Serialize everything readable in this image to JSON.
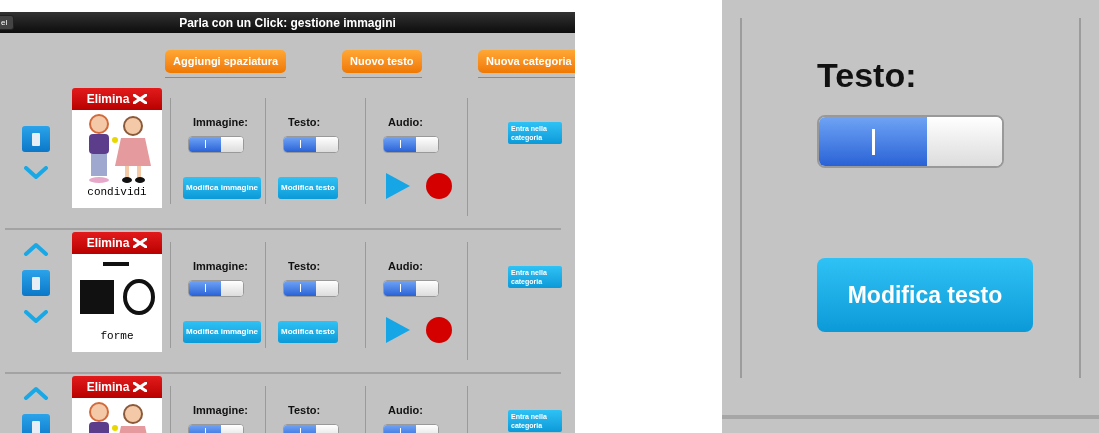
{
  "app": {
    "back_button": "el",
    "title": "Parla con un Click: gestione immagini",
    "toolbar": [
      "Aggiungi spaziatura",
      "Nuovo testo",
      "Nuova categoria"
    ],
    "rows": [
      {
        "has_up": false,
        "has_down": true,
        "delete": "Elimina",
        "picture": {
          "kind": "people",
          "caption": "condividi"
        },
        "settings": [
          {
            "label": "Immagine:",
            "on": true,
            "button": "Modifica immagine"
          },
          {
            "label": "Testo:",
            "on": true,
            "button": "Modifica testo"
          },
          {
            "label": "Audio:",
            "on": true,
            "audio_controls": true
          }
        ],
        "enter": "Entra nella categoria"
      },
      {
        "has_up": true,
        "has_down": true,
        "delete": "Elimina",
        "picture": {
          "kind": "shapes",
          "caption": "forme"
        },
        "settings": [
          {
            "label": "Immagine:",
            "on": true,
            "button": "Modifica immagine"
          },
          {
            "label": "Testo:",
            "on": true,
            "button": "Modifica testo"
          },
          {
            "label": "Audio:",
            "on": true,
            "audio_controls": true
          }
        ],
        "enter": "Entra nella categoria"
      },
      {
        "has_up": true,
        "has_down": false,
        "delete": "Elimina",
        "picture": {
          "kind": "people"
        },
        "settings": [
          {
            "label": "Immagine:",
            "on": true
          },
          {
            "label": "Testo:",
            "on": true
          },
          {
            "label": "Audio:",
            "on": true
          }
        ],
        "enter": "Entra nella categoria"
      }
    ]
  },
  "zoom_inset": {
    "label": "Testo:",
    "on": true,
    "button": "Modifica testo"
  }
}
